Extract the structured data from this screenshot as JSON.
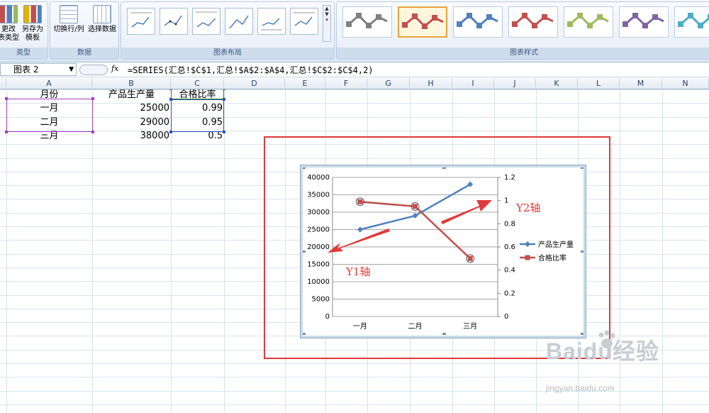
{
  "ribbon": {
    "type_group": {
      "label": "类型",
      "change_label_1": "更改",
      "change_label_2": "表类型",
      "saveas_label_1": "另存为",
      "saveas_label_2": "模板"
    },
    "data_group": {
      "label": "数据",
      "switch_label": "切换行/列",
      "select_label": "选择数据"
    },
    "layout_group": {
      "label": "图表布局"
    },
    "style_group": {
      "label": "图表样式",
      "colors": [
        "#808080",
        "#c0504d",
        "#4f81bd",
        "#c0504d",
        "#9bbb59",
        "#8064a2",
        "#4bacc6"
      ],
      "selected_index": 1
    }
  },
  "formula_bar": {
    "name_box": "图表 2",
    "formula": "=SERIES(汇总!$C$1,汇总!$A$2:$A$4,汇总!$C$2:$C$4,2)"
  },
  "columns": [
    "A",
    "B",
    "C",
    "D",
    "E",
    "F",
    "G",
    "H",
    "I",
    "J",
    "K",
    "L",
    "M",
    "N"
  ],
  "sheet": {
    "headers": [
      "月份",
      "产品生产量",
      "合格比率"
    ],
    "rows": [
      [
        "一月",
        "25000",
        "0.99"
      ],
      [
        "二月",
        "29000",
        "0.95"
      ],
      [
        "三月",
        "38000",
        "0.5"
      ]
    ]
  },
  "annotations": {
    "y1": "Y1轴",
    "y2": "Y2轴",
    "color": "#e03a3a"
  },
  "chart_data": {
    "type": "line",
    "categories": [
      "一月",
      "二月",
      "三月"
    ],
    "series": [
      {
        "name": "产品生产量",
        "values": [
          25000,
          29000,
          38000
        ],
        "axis": "primary",
        "color": "#4f81bd"
      },
      {
        "name": "合格比率",
        "values": [
          0.99,
          0.95,
          0.5
        ],
        "axis": "secondary",
        "color": "#c0504d"
      }
    ],
    "y1_ticks": [
      "0",
      "5000",
      "10000",
      "15000",
      "20000",
      "25000",
      "30000",
      "35000",
      "40000"
    ],
    "y2_ticks": [
      "0",
      "0.2",
      "0.4",
      "0.6",
      "0.8",
      "1",
      "1.2"
    ],
    "y1lim": [
      0,
      40000
    ],
    "y2lim": [
      0,
      1.2
    ],
    "grid": true,
    "legend": "right"
  },
  "watermark": {
    "logo": "Baidu经验",
    "url": "jingyan.baidu.com"
  }
}
